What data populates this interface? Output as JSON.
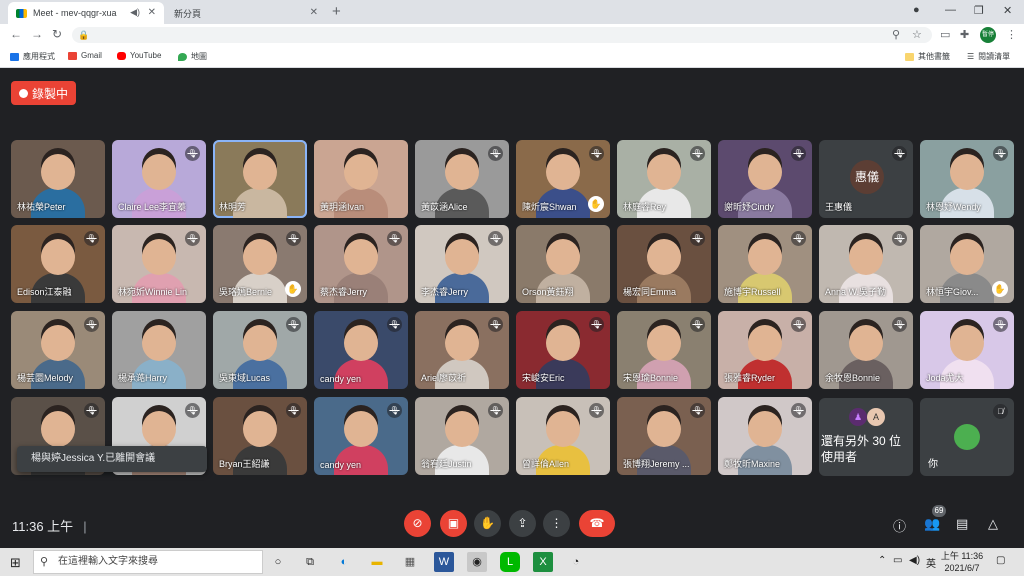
{
  "browser": {
    "tabs": [
      {
        "title": "Meet - mev-qqgr-xua",
        "active": true
      },
      {
        "title": "新分頁",
        "active": false
      }
    ],
    "bookmarks": [
      {
        "label": "應用程式",
        "icon": "apps-grid-icon"
      },
      {
        "label": "Gmail",
        "icon": "gmail-icon"
      },
      {
        "label": "YouTube",
        "icon": "youtube-icon"
      },
      {
        "label": "地圖",
        "icon": "maps-pin-icon"
      }
    ],
    "bookmarks_right": {
      "other_bookmarks": "其他書籤",
      "reading_list": "閱讀清單"
    },
    "profile_label": "暫停"
  },
  "meet": {
    "recording_label": "錄製中",
    "tiles": [
      {
        "name": "林祐榮Peter",
        "muted": false,
        "hand": false,
        "bg": "#6b5a4e",
        "shirt": "#2a6ea0"
      },
      {
        "name": "Claire Lee李宜蓁",
        "muted": true,
        "hand": false,
        "bg": "#b8a9d9",
        "shirt": "#c9a0d8"
      },
      {
        "name": "林明芳",
        "muted": false,
        "hand": false,
        "bg": "#8a7a5a",
        "shirt": "#c9b7a0",
        "active": true
      },
      {
        "name": "黃玥涵Ivan",
        "muted": false,
        "hand": false,
        "bg": "#caa592",
        "shirt": "#b98d7a"
      },
      {
        "name": "黃苡涵Alice",
        "muted": true,
        "hand": false,
        "bg": "#9a9a9a",
        "shirt": "#5a5a5a"
      },
      {
        "name": "陳炘宸Shwan",
        "muted": true,
        "hand": true,
        "bg": "#8a6a4a",
        "shirt": "#3b4f8a"
      },
      {
        "name": "林庭睿Rey",
        "muted": true,
        "hand": false,
        "bg": "#a9b0a5",
        "shirt": "#e8e8e8"
      },
      {
        "name": "謝昕妤Cindy",
        "muted": true,
        "hand": false,
        "bg": "#5c4a6e",
        "shirt": "#8a7aa0"
      },
      {
        "name": "王惠儀",
        "muted": true,
        "hand": false,
        "initials": "惠儀"
      },
      {
        "name": "林恩妤Wendy",
        "muted": true,
        "hand": false,
        "bg": "#8aa0a0",
        "shirt": "#d7e0e8"
      },
      {
        "name": "Edison江泰融",
        "muted": true,
        "hand": false,
        "bg": "#7a5a40",
        "shirt": "#3a3a3a"
      },
      {
        "name": "林宛妡Winnie Lin",
        "muted": true,
        "hand": false,
        "bg": "#c8b8b0",
        "shirt": "#e0a0b0"
      },
      {
        "name": "吳珞嫣Bernie",
        "muted": true,
        "hand": true,
        "bg": "#8a7a70",
        "shirt": "#d8d0c8"
      },
      {
        "name": "蔡杰睿Jerry",
        "muted": true,
        "hand": false,
        "bg": "#b0958a",
        "shirt": "#9a8078"
      },
      {
        "name": "李杰睿Jerry",
        "muted": true,
        "hand": false,
        "bg": "#d0c8c0",
        "shirt": "#4a6a9a"
      },
      {
        "name": "Orson黃鈺翔",
        "muted": false,
        "hand": false,
        "bg": "#8a7a6a",
        "shirt": "#c0b0a0"
      },
      {
        "name": "楊宏同Emma",
        "muted": true,
        "hand": false,
        "bg": "#6a5040",
        "shirt": "#9a7a60"
      },
      {
        "name": "施博宇Russell",
        "muted": true,
        "hand": false,
        "bg": "#a09080",
        "shirt": "#d8c870"
      },
      {
        "name": "Anna W.吳子勤",
        "muted": true,
        "hand": false,
        "bg": "#c0b8b0",
        "shirt": "#e8e0e0"
      },
      {
        "name": "林恒宇Giov...",
        "muted": false,
        "hand": true,
        "bg": "#b0a8a0",
        "shirt": "#8a8a8a"
      },
      {
        "name": "楊芸圜Melody",
        "muted": true,
        "hand": false,
        "bg": "#9a8a78",
        "shirt": "#4a6a8a"
      },
      {
        "name": "楊承澔Harry",
        "muted": false,
        "hand": false,
        "bg": "#a0a0a0",
        "shirt": "#8ab0c8"
      },
      {
        "name": "吳東域Lucas",
        "muted": true,
        "hand": false,
        "bg": "#a0a8a8",
        "shirt": "#4a70a0"
      },
      {
        "name": "candy yen",
        "muted": true,
        "hand": false,
        "bg": "#3a4a6a",
        "shirt": "#d04060"
      },
      {
        "name": "Ariel廖苡祈",
        "muted": true,
        "hand": false,
        "bg": "#8a7060",
        "shirt": "#d0c8c0"
      },
      {
        "name": "宋峻安Eric",
        "muted": true,
        "hand": false,
        "bg": "#8a2a30",
        "shirt": "#3a3a5a"
      },
      {
        "name": "宋恩瑜Bonnie",
        "muted": true,
        "hand": false,
        "bg": "#8a8070",
        "shirt": "#d0a0b0"
      },
      {
        "name": "張雅睿Ryder",
        "muted": true,
        "hand": false,
        "bg": "#c8b0a8",
        "shirt": "#c03030"
      },
      {
        "name": "余牧恩Bonnie",
        "muted": true,
        "hand": false,
        "bg": "#a09890",
        "shirt": "#6a6060"
      },
      {
        "name": "Joda尤大",
        "muted": true,
        "hand": false,
        "bg": "#d8c8e8",
        "shirt": "#f0e0f0"
      },
      {
        "name": "",
        "muted": true,
        "hand": false,
        "bg": "#5a5048",
        "shirt": "#3a3a3a"
      },
      {
        "name": "",
        "muted": true,
        "hand": false,
        "bg": "#d0d0d0",
        "shirt": "#b09080"
      },
      {
        "name": "Bryan王紹謙",
        "muted": true,
        "hand": false,
        "bg": "#6a5040",
        "shirt": "#3a3a3a"
      },
      {
        "name": "candy yen",
        "muted": true,
        "hand": false,
        "bg": "#4a6a8a",
        "shirt": "#d04060"
      },
      {
        "name": "翁宥廷Justin",
        "muted": true,
        "hand": false,
        "bg": "#b0a8a0",
        "shirt": "#e8e8e8"
      },
      {
        "name": "曾詳倫Allen",
        "muted": true,
        "hand": false,
        "bg": "#c8c0b8",
        "shirt": "#e8c040"
      },
      {
        "name": "張博翔Jeremy ...",
        "muted": true,
        "hand": false,
        "bg": "#7a6050",
        "shirt": "#5a5a6a"
      },
      {
        "name": "鄭牧昕Maxine",
        "muted": true,
        "hand": false,
        "bg": "#d0c8c8",
        "shirt": "#8090a0"
      }
    ],
    "notice": "楊與婷Jessica Y.已離開會議",
    "others_tile": {
      "text": "還有另外 30 位使用者",
      "avatar_letter": "A"
    },
    "you_tile": {
      "name": "你",
      "muted": true
    },
    "time": "11:36 上午",
    "participant_count": "69"
  },
  "taskbar": {
    "search_placeholder": "在這裡輸入文字來搜尋",
    "ime": "英",
    "time": "上午 11:36",
    "date": "2021/6/7"
  }
}
